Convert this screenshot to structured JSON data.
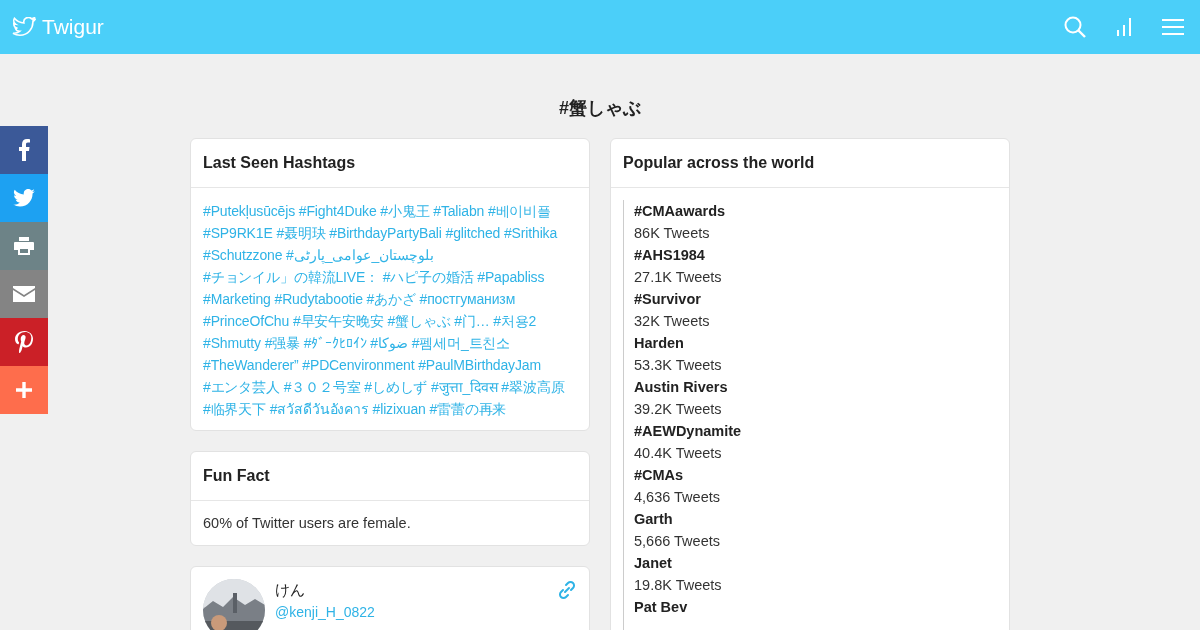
{
  "header": {
    "brand": "Twigur"
  },
  "share": [
    {
      "kind": "facebook",
      "color": "#3b5998"
    },
    {
      "kind": "twitter",
      "color": "#1da1f2"
    },
    {
      "kind": "print",
      "color": "#6d8387"
    },
    {
      "kind": "email",
      "color": "#848484"
    },
    {
      "kind": "pinterest",
      "color": "#cb2027"
    },
    {
      "kind": "more",
      "color": "#fe6d4c"
    }
  ],
  "page_title": "#蟹しゃぶ",
  "last_seen": {
    "title": "Last Seen Hashtags",
    "tags": [
      "#Putekļusūcējs",
      "#Fight4Duke",
      "#小鬼王",
      "#Taliabn",
      "#베이비플",
      "#SP9RK1E",
      "#聂明玦",
      "#BirthdayPartyBali",
      "#glitched",
      "#Srithika",
      "#Schutzzone",
      "#بلوچستان_عوامی_پارٹی",
      "#チョンイル」の韓流LIVE：",
      "#ハピ子の婚活",
      "#Papabliss",
      "#Marketing",
      "#Rudytabootie",
      "#あかざ",
      "#постгуманизм",
      "#PrinceOfChu",
      "#早安午安晚安",
      "#蟹しゃぶ",
      "#门…",
      "#처용2",
      "#Shmutty",
      "#强暴",
      "#ﾀﾞｰｸﾋﾛｲﾝ",
      "#ضوکا",
      "#펨세머_트친소",
      "#TheWanderer”",
      "#PDCenvironment",
      "#PaulMBirthdayJam",
      "#エンタ芸人",
      "#３０２号室",
      "#しめしず",
      "#जुत्ता_दिवस",
      "#翠波高原",
      "#临界天下",
      "#สวัสดีวันอังคาร",
      "#lizixuan",
      "#雷蕾の再来"
    ]
  },
  "fun_fact": {
    "title": "Fun Fact",
    "text": "60% of Twitter users are female."
  },
  "user": {
    "name": "けん",
    "handle": "@kenji_H_0822"
  },
  "popular": {
    "title": "Popular across the world",
    "trends": [
      {
        "name": "#CMAawards",
        "count": "86K Tweets"
      },
      {
        "name": "#AHS1984",
        "count": "27.1K Tweets"
      },
      {
        "name": "#Survivor",
        "count": "32K Tweets"
      },
      {
        "name": "Harden",
        "count": "53.3K Tweets"
      },
      {
        "name": "Austin Rivers",
        "count": "39.2K Tweets"
      },
      {
        "name": "#AEWDynamite",
        "count": "40.4K Tweets"
      },
      {
        "name": "#CMAs",
        "count": "4,636 Tweets"
      },
      {
        "name": "Garth",
        "count": "5,666 Tweets"
      },
      {
        "name": "Janet",
        "count": "19.8K Tweets"
      },
      {
        "name": "Pat Bev"
      }
    ]
  }
}
